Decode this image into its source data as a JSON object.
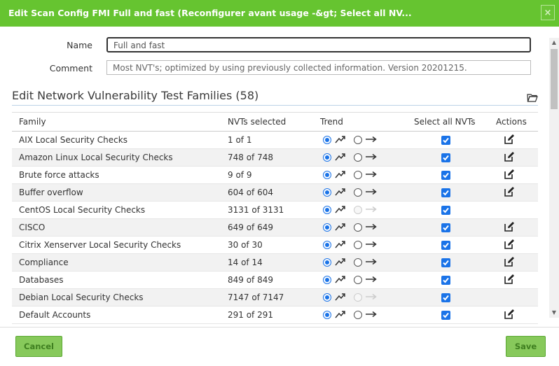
{
  "dialog": {
    "title": "Edit Scan Config FMI Full and fast (Reconfigurer avant usage -&gt; Select all NV...",
    "close_label": "×"
  },
  "form": {
    "name_label": "Name",
    "name_value": "Full and fast",
    "comment_label": "Comment",
    "comment_value": "Most NVT's; optimized by using previously collected information. Version 20201215."
  },
  "section": {
    "title": "Edit Network Vulnerability Test Families (58)",
    "icon": "folder-icon"
  },
  "table": {
    "headers": {
      "family": "Family",
      "nvts": "NVTs selected",
      "trend": "Trend",
      "select_all": "Select all NVTs",
      "actions": "Actions"
    },
    "rows": [
      {
        "family": "AIX Local Security Checks",
        "nvts": "1 of 1",
        "trend": "dynamic",
        "static_enabled": true,
        "select_all": true,
        "edit": true
      },
      {
        "family": "Amazon Linux Local Security Checks",
        "nvts": "748 of 748",
        "trend": "dynamic",
        "static_enabled": true,
        "select_all": true,
        "edit": true
      },
      {
        "family": "Brute force attacks",
        "nvts": "9 of 9",
        "trend": "dynamic",
        "static_enabled": true,
        "select_all": true,
        "edit": true
      },
      {
        "family": "Buffer overflow",
        "nvts": "604 of 604",
        "trend": "dynamic",
        "static_enabled": true,
        "select_all": true,
        "edit": true
      },
      {
        "family": "CentOS Local Security Checks",
        "nvts": "3131 of 3131",
        "trend": "dynamic",
        "static_enabled": false,
        "select_all": true,
        "edit": false
      },
      {
        "family": "CISCO",
        "nvts": "649 of 649",
        "trend": "dynamic",
        "static_enabled": true,
        "select_all": true,
        "edit": true
      },
      {
        "family": "Citrix Xenserver Local Security Checks",
        "nvts": "30 of 30",
        "trend": "dynamic",
        "static_enabled": true,
        "select_all": true,
        "edit": true
      },
      {
        "family": "Compliance",
        "nvts": "14 of 14",
        "trend": "dynamic",
        "static_enabled": true,
        "select_all": true,
        "edit": true
      },
      {
        "family": "Databases",
        "nvts": "849 of 849",
        "trend": "dynamic",
        "static_enabled": true,
        "select_all": true,
        "edit": true
      },
      {
        "family": "Debian Local Security Checks",
        "nvts": "7147 of 7147",
        "trend": "dynamic",
        "static_enabled": false,
        "select_all": true,
        "edit": false
      },
      {
        "family": "Default Accounts",
        "nvts": "291 of 291",
        "trend": "dynamic",
        "static_enabled": true,
        "select_all": true,
        "edit": true
      }
    ]
  },
  "footer": {
    "cancel_label": "Cancel",
    "save_label": "Save"
  },
  "colors": {
    "title_bar": "#66c430",
    "radio_checkbox": "#1a73e8",
    "button": "#87c95b"
  }
}
